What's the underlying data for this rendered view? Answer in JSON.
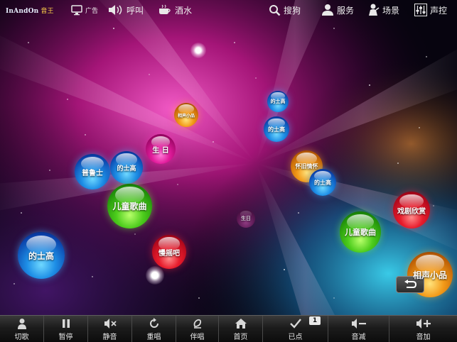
{
  "app": {
    "logo_text": "InAndOn",
    "logo_sub": "音王"
  },
  "topbar": {
    "ad_label": "广告",
    "call_label": "呼叫",
    "drinks_label": "酒水",
    "search_label": "搜狗",
    "service_label": "服务",
    "scene_label": "场景",
    "sound_label": "声控"
  },
  "bubbles": [
    {
      "label": "的士高",
      "color": "blue"
    },
    {
      "label": "的士高",
      "color": "blue"
    },
    {
      "label": "相声小品",
      "color": "orange"
    },
    {
      "label": "生 日",
      "color": "magenta"
    },
    {
      "label": "普鲁士",
      "color": "blue"
    },
    {
      "label": "的士高",
      "color": "blue"
    },
    {
      "label": "怀旧情怀",
      "color": "orange"
    },
    {
      "label": "的士高",
      "color": "blue"
    },
    {
      "label": "儿童歌曲",
      "color": "green"
    },
    {
      "label": "戏剧欣赏",
      "color": "red"
    },
    {
      "label": "生日",
      "color": "dim"
    },
    {
      "label": "儿童歌曲",
      "color": "green"
    },
    {
      "label": "的士高",
      "color": "blue"
    },
    {
      "label": "慢摇吧",
      "color": "red"
    },
    {
      "label": "相声小品",
      "color": "orange"
    }
  ],
  "bottombar": {
    "cut_song": "切歌",
    "pause": "暂停",
    "mute": "静音",
    "replay": "重唱",
    "accompany": "伴唱",
    "home": "首页",
    "ordered": "已点",
    "ordered_count": "1",
    "vol_down": "音减",
    "vol_up": "音加"
  },
  "colors": {
    "blue": "#1e8fe6",
    "green": "#4ccc1c",
    "red": "#e81c2c",
    "orange": "#f39a18",
    "magenta": "#e21c9c"
  }
}
